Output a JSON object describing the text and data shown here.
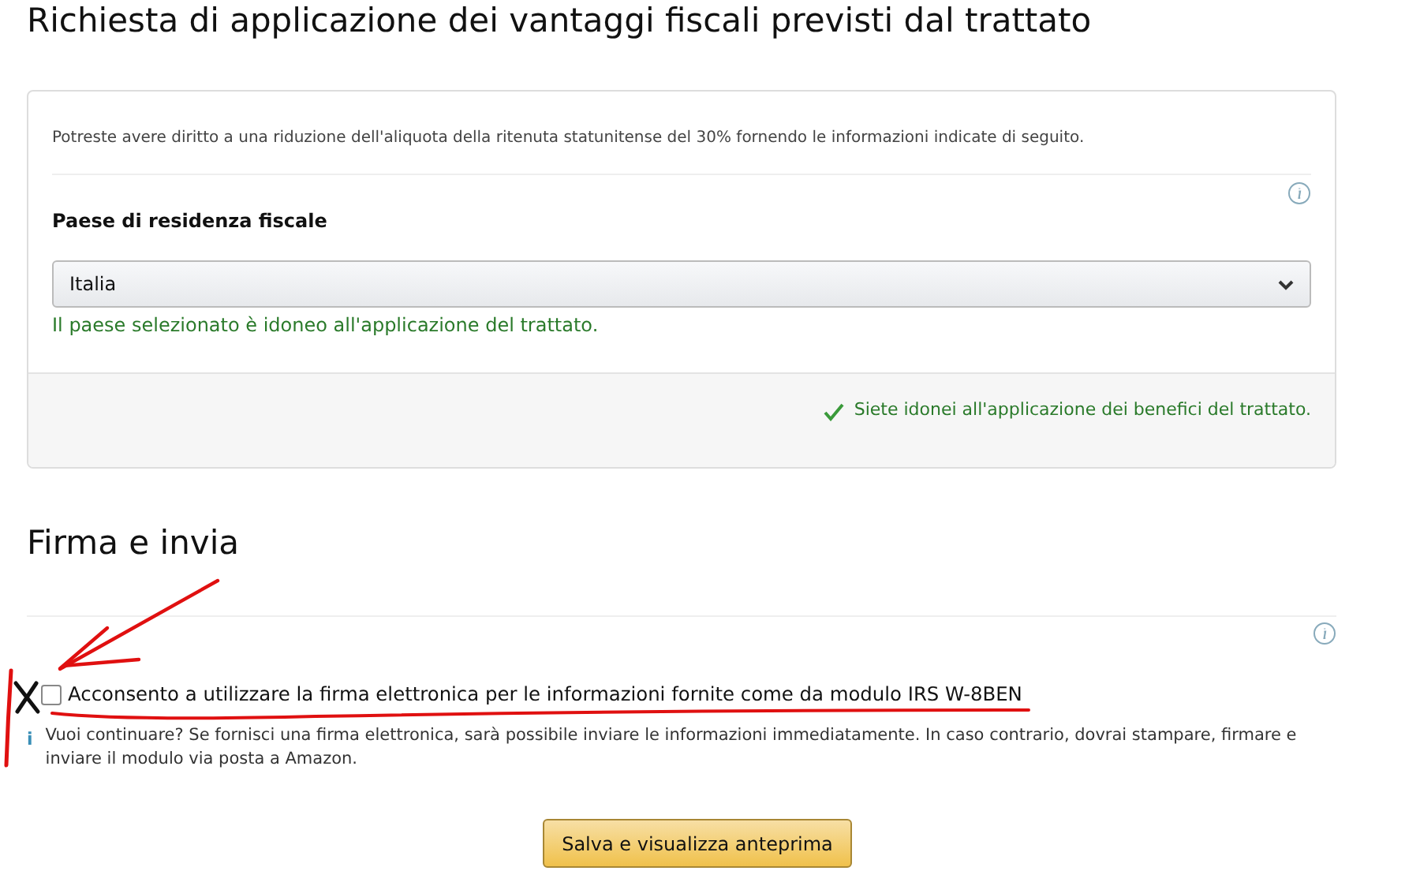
{
  "title": "Richiesta di applicazione dei vantaggi fiscali previsti dal trattato",
  "treaty_card": {
    "intro": "Potreste avere diritto a una riduzione dell'aliquota della ritenuta statunitense del 30% fornendo le informazioni indicate di seguito.",
    "country_label": "Paese di residenza fiscale",
    "country_value": "Italia",
    "country_status": "Il paese selezionato è idoneo all'applicazione del trattato.",
    "eligibility": "Siete idonei all'applicazione dei benefici del trattato."
  },
  "sign_section": {
    "title": "Firma e invia",
    "consent": {
      "label": "Acconsento a utilizzare la firma elettronica per le informazioni fornite come da modulo IRS W-8BEN",
      "checked": false
    },
    "info_icon_char": "i",
    "info": "Vuoi continuare? Se fornisci una firma elettronica, sarà possibile inviare le informazioni immediatamente. In caso contrario, dovrai stampare, firmare e inviare il modulo via posta a Amazon.",
    "button": "Salva e visualizza anteprima"
  }
}
